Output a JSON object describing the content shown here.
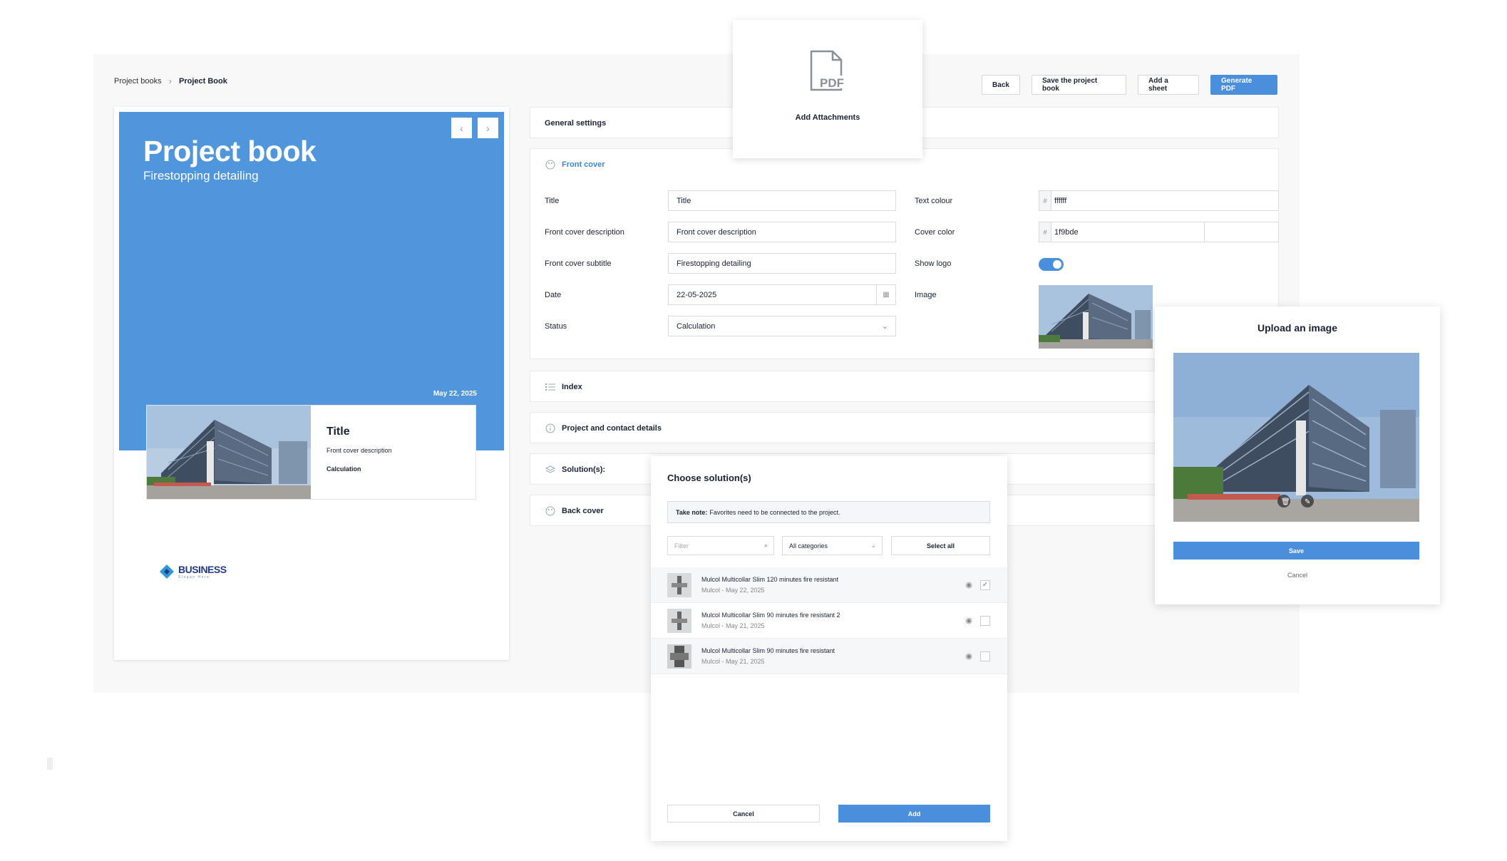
{
  "breadcrumb": {
    "parent": "Project books",
    "current": "Project Book"
  },
  "toolbar": {
    "back": "Back",
    "save": "Save the project book",
    "add_sheet": "Add a sheet",
    "generate": "Generate PDF"
  },
  "preview": {
    "title": "Project book",
    "subtitle": "Firestopping detailing",
    "date": "May 22, 2025",
    "card_title": "Title",
    "card_description": "Front cover description",
    "card_status": "Calculation",
    "logo_text": "BUSINESS",
    "logo_tagline": "Slogan Here"
  },
  "sections": {
    "general": "General settings",
    "front_cover": "Front cover",
    "index": "Index",
    "project_contact": "Project and contact details",
    "solutions": "Solution(s):",
    "back_cover": "Back cover"
  },
  "form": {
    "title_label": "Title",
    "title_value": "Title",
    "desc_label": "Front cover description",
    "desc_value": "Front cover description",
    "subtitle_label": "Front cover subtitle",
    "subtitle_value": "Firestopping detailing",
    "date_label": "Date",
    "date_value": "22-05-2025",
    "status_label": "Status",
    "status_value": "Calculation",
    "text_colour_label": "Text colour",
    "text_colour_value": "ffffff",
    "cover_color_label": "Cover color",
    "cover_color_value": "1f9bde",
    "show_logo_label": "Show logo",
    "image_label": "Image",
    "hash": "#"
  },
  "pdf_card": {
    "icon_text": "PDF",
    "label": "Add Attachments"
  },
  "upload": {
    "title": "Upload an image",
    "save": "Save",
    "cancel": "Cancel"
  },
  "choose": {
    "title": "Choose solution(s)",
    "note_bold": "Take note:",
    "note_text": "Favorites need to be connected to the project.",
    "filter_placeholder": "Filter",
    "category": "All categories",
    "select_all": "Select all",
    "items": [
      {
        "name": "Mulcol Multicollar Slim 120 minutes fire resistant",
        "meta": "Mulcol - May 22, 2025",
        "checked": "✓"
      },
      {
        "name": "Mulcol Multicollar Slim 90 minutes fire resistant 2",
        "meta": "Mulcol - May 21, 2025",
        "checked": ""
      },
      {
        "name": "Mulcol Multicollar Slim 90 minutes fire resistant",
        "meta": "Mulcol - May 21, 2025",
        "checked": ""
      }
    ],
    "cancel": "Cancel",
    "add": "Add"
  },
  "colors": {
    "accent": "#4a8fdc",
    "cover": "#4f96dc"
  }
}
